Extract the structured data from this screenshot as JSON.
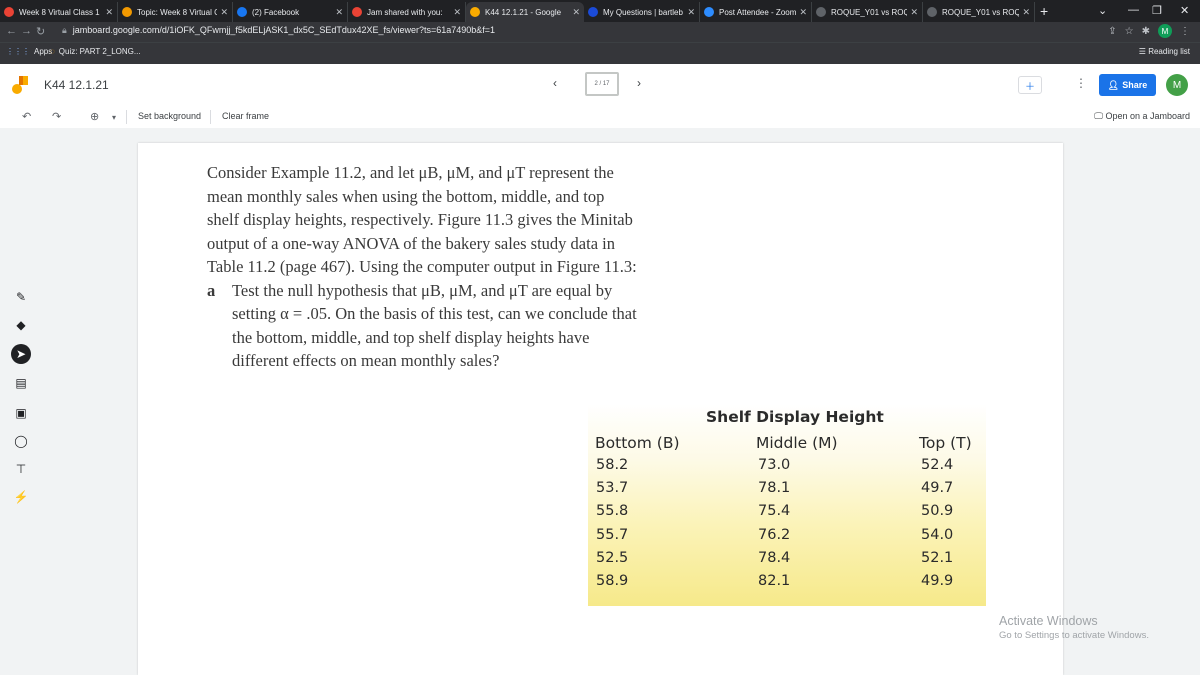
{
  "browser": {
    "tabs": [
      {
        "label": "Week 8 Virtual Class 1",
        "icon": "gmail-icon",
        "color": "#ea4335"
      },
      {
        "label": "Topic: Week 8 Virtual C",
        "icon": "loading-icon",
        "color": "#f29900"
      },
      {
        "label": "(2) Facebook",
        "icon": "facebook-icon",
        "color": "#1877f2"
      },
      {
        "label": "Jam shared with you:",
        "icon": "gmail-icon",
        "color": "#ea4335"
      },
      {
        "label": "K44 12.1.21 - Google",
        "icon": "jamboard-icon",
        "color": "#f9ab00",
        "active": true
      },
      {
        "label": "My Questions | bartleb",
        "icon": "bartleby-icon",
        "color": "#1b4bd8"
      },
      {
        "label": "Post Attendee - Zoom",
        "icon": "zoom-icon",
        "color": "#2d8cff"
      },
      {
        "label": "ROQUE_Y01 vs ROQUE",
        "icon": "compare-icon",
        "color": "#5f6368"
      },
      {
        "label": "ROQUE_Y01 vs ROQUE",
        "icon": "compare-icon",
        "color": "#5f6368"
      }
    ],
    "url": "jamboard.google.com/d/1iOFK_QFwmjj_f5kdELjASK1_dx5C_SEdTdux42XE_fs/viewer?ts=61a7490b&f=1",
    "bookmarks": [
      {
        "label": "Apps",
        "icon": "apps-grid-icon"
      },
      {
        "label": "Quiz: PART 2_LONG...",
        "icon": "loading-icon"
      }
    ],
    "reading_list": "Reading list",
    "profile_initial": "M"
  },
  "jamboard": {
    "title": "K44 12.1.21",
    "frame_indicator": "2 / 17",
    "share_label": "Share",
    "user_initial": "M",
    "toolbar": {
      "set_background": "Set background",
      "clear_frame": "Clear frame",
      "open_jamboard": "Open on a Jamboard"
    }
  },
  "problem": {
    "intro": "Consider Example 11.2, and let μB, μM, and μT represent the mean monthly sales when using the bottom, middle, and top shelf display heights, respectively. Figure 11.3 gives the Minitab output of a one-way ANOVA of the bakery sales study data in Table 11.2 (page 467). Using the computer output in Figure 11.3:",
    "part_label": "a",
    "part_text": "Test the null hypothesis that μB, μM, and μT are equal by setting α = .05. On the basis of this test, can we conclude that the bottom, middle, and top shelf display heights have different effects on mean monthly sales?"
  },
  "table": {
    "caption": "Shelf Display Height",
    "headers": [
      "Bottom (B)",
      "Middle (M)",
      "Top (T)"
    ],
    "rows": [
      [
        "58.2",
        "73.0",
        "52.4"
      ],
      [
        "53.7",
        "78.1",
        "49.7"
      ],
      [
        "55.8",
        "75.4",
        "50.9"
      ],
      [
        "55.7",
        "76.2",
        "54.0"
      ],
      [
        "52.5",
        "78.4",
        "52.1"
      ],
      [
        "58.9",
        "82.1",
        "49.9"
      ]
    ]
  },
  "watermark": {
    "line1": "Activate Windows",
    "line2": "Go to Settings to activate Windows."
  },
  "colors": {
    "accent": "#1a73e8",
    "table_highlight": "#f6e98a"
  }
}
